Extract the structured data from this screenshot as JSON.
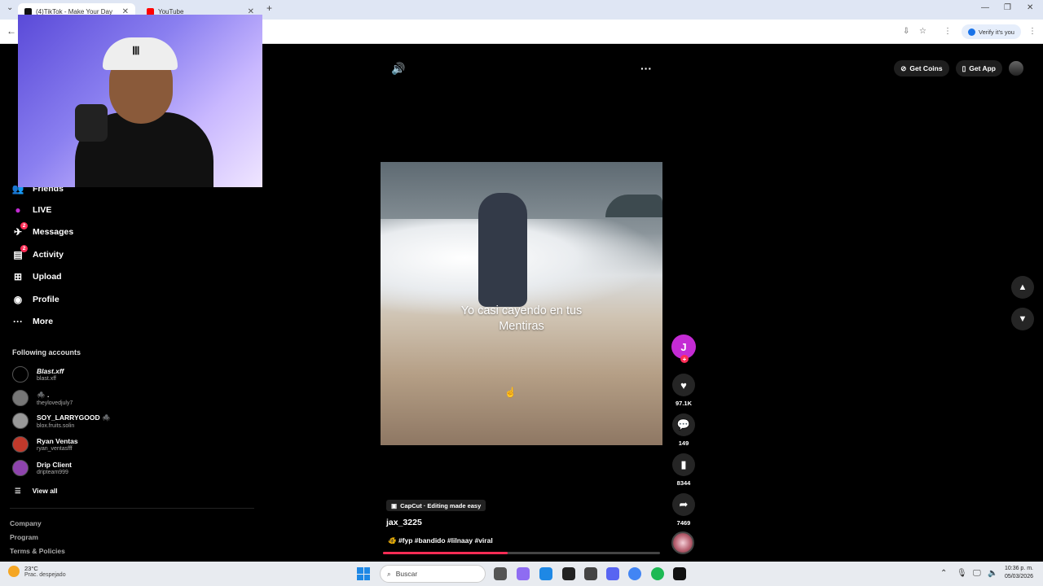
{
  "browser": {
    "tabs": [
      {
        "label": "(4)TikTok - Make Your Day",
        "active": true,
        "favicon_color": "#111111"
      },
      {
        "label": "YouTube",
        "active": false,
        "favicon_color": "#ff0000"
      }
    ],
    "new_tab_icon": "plus-icon",
    "verify_label": "Verify it's you"
  },
  "sidebar": {
    "items": [
      {
        "label": "Friends",
        "icon": "friends-icon",
        "glyph": "👥",
        "badge": ""
      },
      {
        "label": "LIVE",
        "icon": "live-icon",
        "glyph": "●",
        "badge": ""
      },
      {
        "label": "Messages",
        "icon": "messages-icon",
        "glyph": "✈",
        "badge": "2"
      },
      {
        "label": "Activity",
        "icon": "activity-icon",
        "glyph": "▤",
        "badge": "2"
      },
      {
        "label": "Upload",
        "icon": "upload-icon",
        "glyph": "⊞",
        "badge": ""
      },
      {
        "label": "Profile",
        "icon": "profile-icon",
        "glyph": "◉",
        "badge": ""
      },
      {
        "label": "More",
        "icon": "more-icon",
        "glyph": "···",
        "badge": ""
      }
    ],
    "following_title": "Following accounts",
    "accounts": [
      {
        "name": "Blast.xff",
        "handle": "blast.xff"
      },
      {
        "name": "🕷️ .",
        "handle": "theylovedjuly7"
      },
      {
        "name": "SOY_LARRYGOOD 🕷️",
        "handle": "blox.fruits.solin"
      },
      {
        "name": "Ryan Ventas",
        "handle": "ryan_ventasfff"
      },
      {
        "name": "Drip Client",
        "handle": "dripteam999"
      }
    ],
    "view_all": "View all",
    "footer": [
      "Company",
      "Program",
      "Terms & Policies"
    ]
  },
  "header": {
    "get_coins": "Get Coins",
    "get_app": "Get App"
  },
  "video": {
    "caption_line1": "Yo casi cayendo en tus",
    "caption_line2": "Mentiras",
    "creator_initial": "J",
    "likes": "97.1K",
    "comments": "149",
    "saves": "8344",
    "shares": "7469",
    "capcut_label": "CapCut · Editing made easy",
    "username": "jax_3225",
    "tags": "🐠 #fyp #bandido #lilnaay #viral",
    "progress": 0.45
  },
  "webcam": {
    "cap_mark": "Ⅲ"
  },
  "taskbar": {
    "temperature": "23°C",
    "weather": "Prac. despejado",
    "search_placeholder": "Buscar",
    "time": "10:36 p. m.",
    "date": "05/03/2026"
  },
  "colors": {
    "accent": "#fe2c55",
    "creator_avatar": "#c42bd4"
  }
}
